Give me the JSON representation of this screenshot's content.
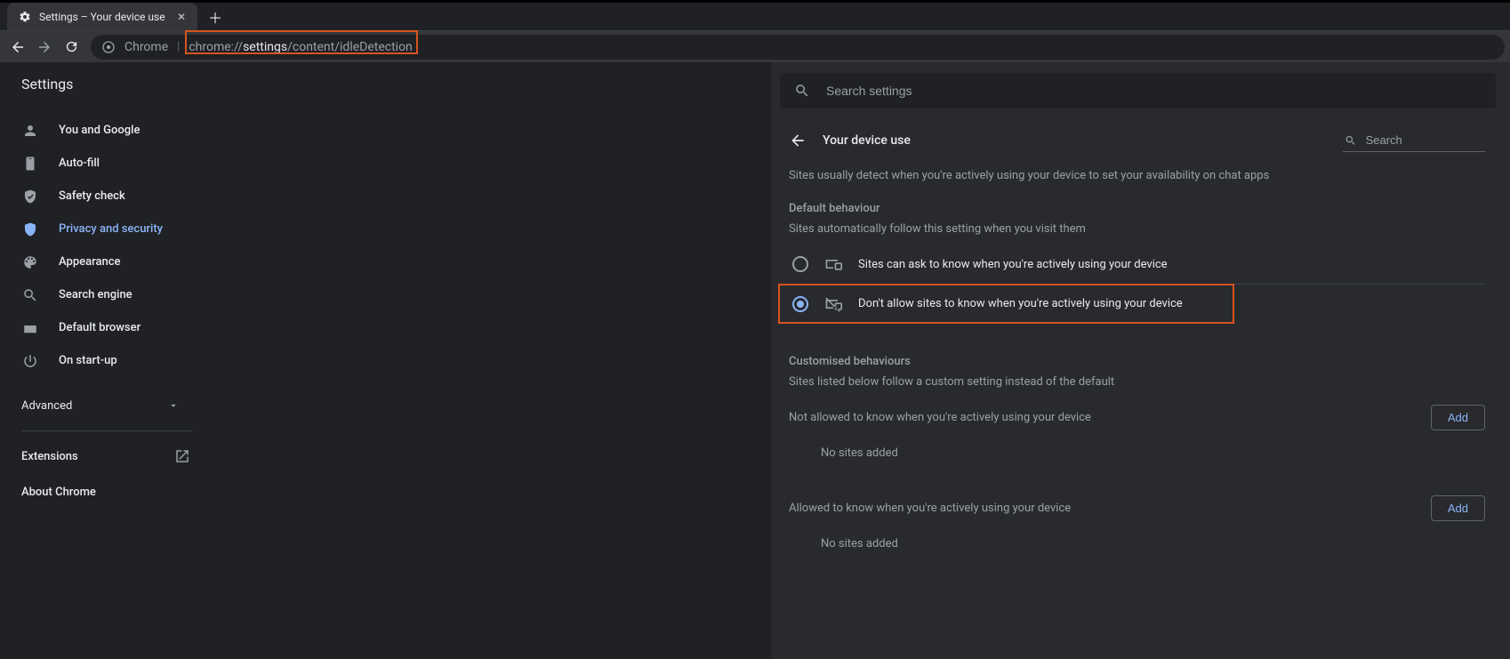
{
  "tab": {
    "title": "Settings – Your device use"
  },
  "addressbar": {
    "chrome_label": "Chrome",
    "url_prefix": "chrome://",
    "url_bold": "settings",
    "url_suffix": "/content/idleDetection"
  },
  "app_title": "Settings",
  "sidebar": {
    "items": [
      {
        "label": "You and Google"
      },
      {
        "label": "Auto-fill"
      },
      {
        "label": "Safety check"
      },
      {
        "label": "Privacy and security"
      },
      {
        "label": "Appearance"
      },
      {
        "label": "Search engine"
      },
      {
        "label": "Default browser"
      },
      {
        "label": "On start-up"
      }
    ],
    "advanced": "Advanced",
    "extensions": "Extensions",
    "about": "About Chrome"
  },
  "search_placeholder": "Search settings",
  "panel": {
    "title": "Your device use",
    "search_placeholder": "Search",
    "description": "Sites usually detect when you're actively using your device to set your availability on chat apps",
    "default_title": "Default behaviour",
    "default_sub": "Sites automatically follow this setting when you visit them",
    "option_allow": "Sites can ask to know when you're actively using your device",
    "option_block": "Don't allow sites to know when you're actively using your device",
    "custom_title": "Customised behaviours",
    "custom_sub": "Sites listed below follow a custom setting instead of the default",
    "not_allowed_label": "Not allowed to know when you're actively using your device",
    "allowed_label": "Allowed to know when you're actively using your device",
    "add_label": "Add",
    "no_sites": "No sites added"
  }
}
